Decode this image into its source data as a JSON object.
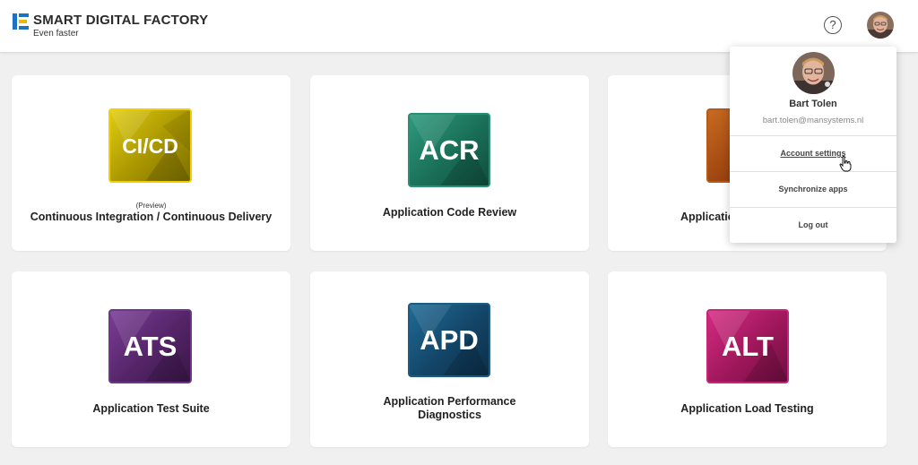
{
  "brand": {
    "title": "SMART DIGITAL FACTORY",
    "subtitle": "Even faster"
  },
  "header": {
    "help_icon": "?"
  },
  "user": {
    "name": "Bart Tolen",
    "email": "bart.tolen@mansystems.nl"
  },
  "menu": {
    "items": [
      {
        "label": "Account settings"
      },
      {
        "label": "Synchronize apps"
      },
      {
        "label": "Log out"
      }
    ]
  },
  "apps": [
    {
      "abbr": "CI/CD",
      "label": "Continuous Integration / Continuous Delivery",
      "badge": "(Preview)",
      "color": "#c9b300"
    },
    {
      "abbr": "ACR",
      "label": "Application Code Review",
      "color": "#1e7a63"
    },
    {
      "abbr": "A",
      "label": "Applicatio",
      "color": "#a0490e"
    },
    {
      "abbr": "ATS",
      "label": "Application Test Suite",
      "color": "#5b2a73"
    },
    {
      "abbr": "APD",
      "label": "Application Performance Diagnostics",
      "label_lines": [
        "Application Performance",
        "Diagnostics"
      ],
      "color": "#14466a"
    },
    {
      "abbr": "ALT",
      "label": "Application Load Testing",
      "color": "#a8195f"
    }
  ],
  "icons": [
    "logo-mark-icon",
    "help-icon",
    "avatar",
    "pointer-cursor-icon"
  ],
  "colors": {
    "background": "#f0f0f0",
    "card": "#ffffff",
    "logo_blue": "#1d72c2",
    "logo_yellow": "#f2b600"
  }
}
